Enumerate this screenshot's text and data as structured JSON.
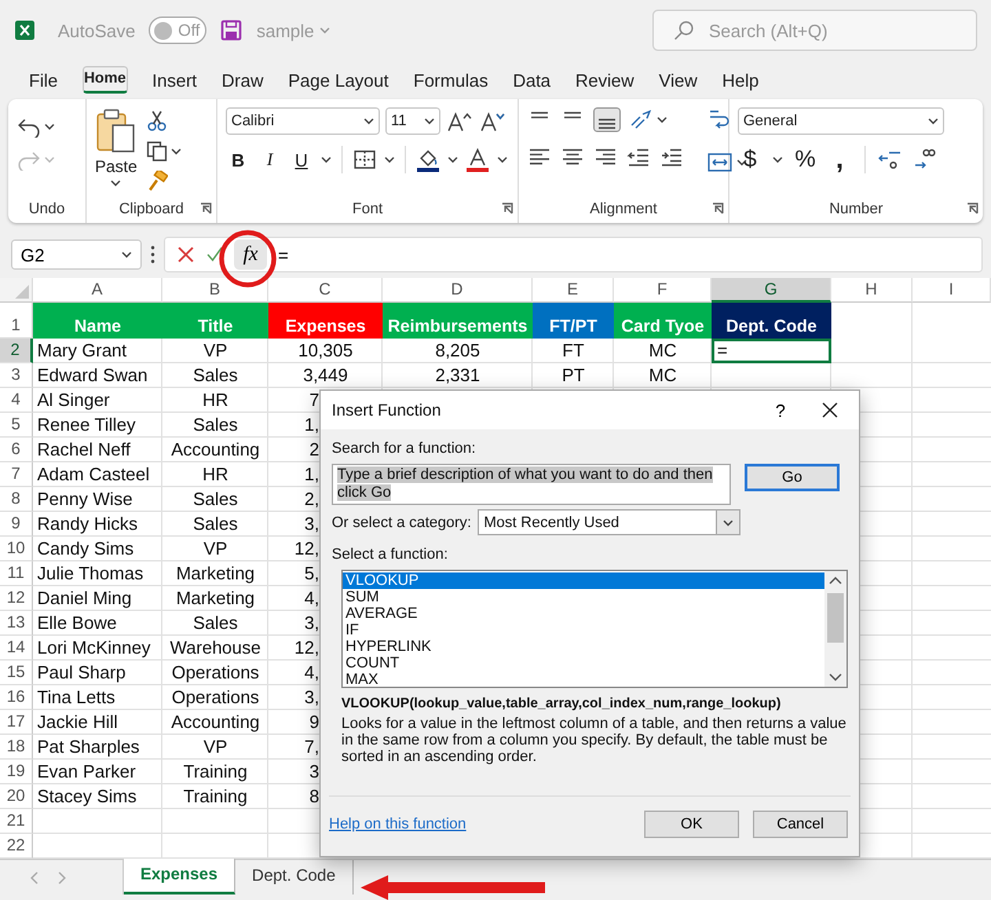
{
  "title_bar": {
    "autosave_label": "AutoSave",
    "autosave": {
      "on": false,
      "label": "Off"
    },
    "file_name": "sample",
    "search": {
      "placeholder": "Search (Alt+Q)"
    }
  },
  "ribbon_tabs": [
    {
      "label": "File",
      "selected": false
    },
    {
      "label": "Home",
      "selected": true
    },
    {
      "label": "Insert",
      "selected": false
    },
    {
      "label": "Draw",
      "selected": false
    },
    {
      "label": "Page Layout",
      "selected": false
    },
    {
      "label": "Formulas",
      "selected": false
    },
    {
      "label": "Data",
      "selected": false
    },
    {
      "label": "Review",
      "selected": false
    },
    {
      "label": "View",
      "selected": false
    },
    {
      "label": "Help",
      "selected": false
    }
  ],
  "ribbon_groups": [
    {
      "kind": "undo",
      "label": "Undo",
      "launcher": false
    },
    {
      "kind": "clipboard",
      "label": "Clipboard",
      "launcher": true,
      "paste_label": "Paste"
    },
    {
      "kind": "font",
      "label": "Font",
      "launcher": true,
      "font_name": "Calibri",
      "font_size": "11",
      "buttons": [
        "B",
        "I",
        "U"
      ]
    },
    {
      "kind": "alignment",
      "label": "Alignment",
      "launcher": true
    },
    {
      "kind": "number",
      "label": "Number",
      "launcher": true,
      "format": "General",
      "buttons": [
        "$",
        "%",
        ","
      ]
    }
  ],
  "formula_bar": {
    "name_box": "G2",
    "fx": "fx",
    "formula": "="
  },
  "sheet": {
    "columns": [
      {
        "label": "A",
        "selected": false
      },
      {
        "label": "B",
        "selected": false
      },
      {
        "label": "C",
        "selected": false
      },
      {
        "label": "D",
        "selected": false
      },
      {
        "label": "E",
        "selected": false
      },
      {
        "label": "F",
        "selected": false
      },
      {
        "label": "G",
        "selected": true
      },
      {
        "label": "H",
        "selected": false
      },
      {
        "label": "I",
        "selected": false
      }
    ],
    "header_row": {
      "number": "1",
      "selected": false,
      "cells": [
        {
          "text": "Name",
          "color": "#00b050"
        },
        {
          "text": "Title",
          "color": "#00b050"
        },
        {
          "text": "Expenses",
          "color": "#ff0000"
        },
        {
          "text": "Reimbursements",
          "color": "#00b050"
        },
        {
          "text": "FT/PT",
          "color": "#0070c0"
        },
        {
          "text": "Card Tyoe",
          "color": "#00b050"
        },
        {
          "text": "Dept. Code",
          "color": "#002060"
        }
      ]
    },
    "rows": [
      {
        "number": "2",
        "selected": true,
        "cells": [
          "Mary Grant",
          "VP",
          "10,305",
          "8,205",
          "FT",
          "MC",
          "="
        ]
      },
      {
        "number": "3",
        "selected": false,
        "cells": [
          "Edward Swan",
          "Sales",
          "3,449",
          "2,331",
          "PT",
          "MC"
        ]
      },
      {
        "number": "4",
        "selected": false,
        "cells": [
          "Al Singer",
          "HR",
          "7"
        ]
      },
      {
        "number": "5",
        "selected": false,
        "cells": [
          "Renee Tilley",
          "Sales",
          "1,"
        ]
      },
      {
        "number": "6",
        "selected": false,
        "cells": [
          "Rachel Neff",
          "Accounting",
          "2"
        ]
      },
      {
        "number": "7",
        "selected": false,
        "cells": [
          "Adam Casteel",
          "HR",
          "1,"
        ]
      },
      {
        "number": "8",
        "selected": false,
        "cells": [
          "Penny Wise",
          "Sales",
          "2,"
        ]
      },
      {
        "number": "9",
        "selected": false,
        "cells": [
          "Randy Hicks",
          "Sales",
          "3,"
        ]
      },
      {
        "number": "10",
        "selected": false,
        "cells": [
          "Candy Sims",
          "VP",
          "12,"
        ]
      },
      {
        "number": "11",
        "selected": false,
        "cells": [
          "Julie Thomas",
          "Marketing",
          "5,"
        ]
      },
      {
        "number": "12",
        "selected": false,
        "cells": [
          "Daniel Ming",
          "Marketing",
          "4,"
        ]
      },
      {
        "number": "13",
        "selected": false,
        "cells": [
          "Elle Bowe",
          "Sales",
          "3,"
        ]
      },
      {
        "number": "14",
        "selected": false,
        "cells": [
          "Lori McKinney",
          "Warehouse",
          "12,"
        ]
      },
      {
        "number": "15",
        "selected": false,
        "cells": [
          "Paul Sharp",
          "Operations",
          "4,"
        ]
      },
      {
        "number": "16",
        "selected": false,
        "cells": [
          "Tina Letts",
          "Operations",
          "3,"
        ]
      },
      {
        "number": "17",
        "selected": false,
        "cells": [
          "Jackie Hill",
          "Accounting",
          "9"
        ]
      },
      {
        "number": "18",
        "selected": false,
        "cells": [
          "Pat Sharples",
          "VP",
          "7,"
        ]
      },
      {
        "number": "19",
        "selected": false,
        "cells": [
          "Evan Parker",
          "Training",
          "3"
        ]
      },
      {
        "number": "20",
        "selected": false,
        "cells": [
          "Stacey Sims",
          "Training",
          "8"
        ]
      },
      {
        "number": "21",
        "selected": false
      },
      {
        "number": "22",
        "selected": false
      }
    ]
  },
  "dialog": {
    "title": "Insert Function",
    "help": "?",
    "search_label": "Search for a function:",
    "search_value": "Type a brief description of what you want to do and then click Go",
    "go": "Go",
    "category_label": "Or select a category:",
    "category": "Most Recently Used",
    "function_label": "Select a function:",
    "functions": [
      {
        "name": "VLOOKUP",
        "selected": true
      },
      {
        "name": "SUM",
        "selected": false
      },
      {
        "name": "AVERAGE",
        "selected": false
      },
      {
        "name": "IF",
        "selected": false
      },
      {
        "name": "HYPERLINK",
        "selected": false
      },
      {
        "name": "COUNT",
        "selected": false
      },
      {
        "name": "MAX",
        "selected": false
      }
    ],
    "signature": "VLOOKUP(lookup_value,table_array,col_index_num,range_lookup)",
    "description": "Looks for a value in the leftmost column of a table, and then returns a value in the same row from a column you specify. By default, the table must be sorted in an ascending order.",
    "help_link": "Help on this function",
    "buttons": [
      "OK",
      "Cancel"
    ]
  },
  "sheet_tabs": [
    {
      "label": "Expenses",
      "selected": true
    },
    {
      "label": "Dept. Code",
      "selected": false
    }
  ]
}
